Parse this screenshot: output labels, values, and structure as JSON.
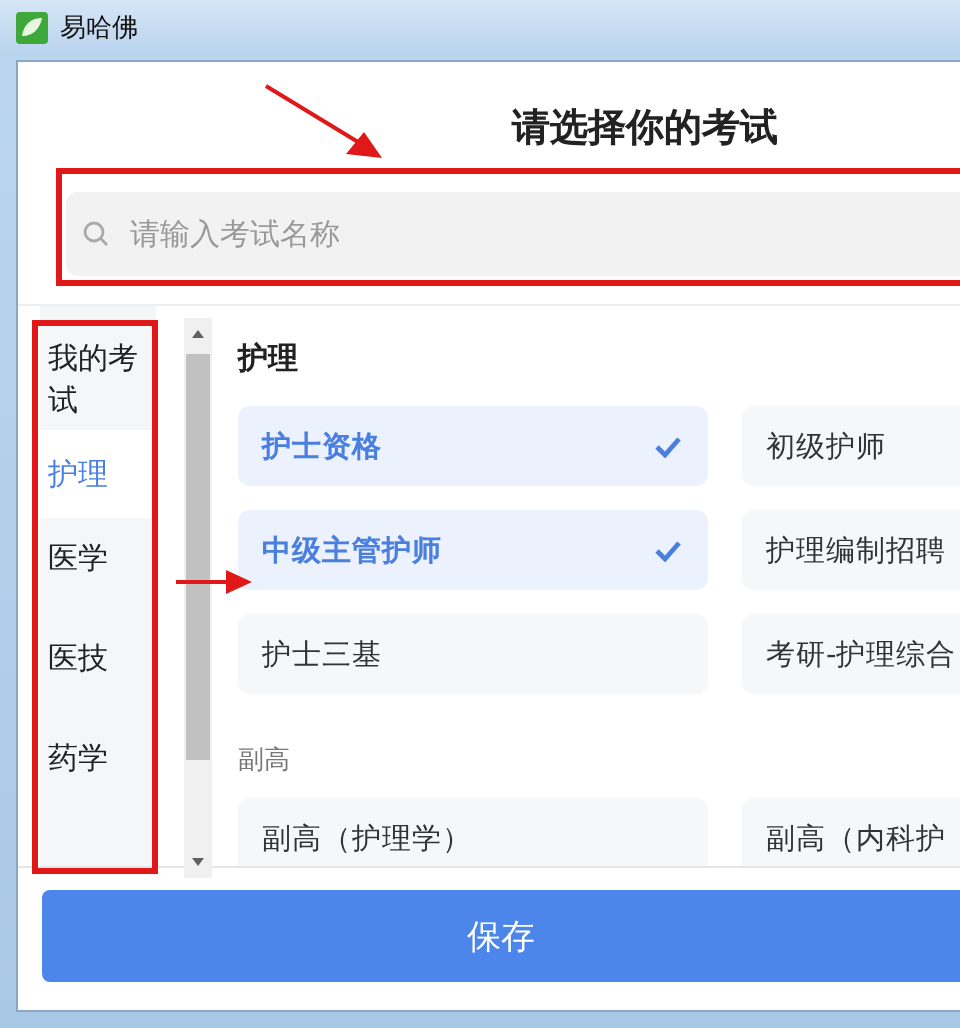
{
  "window": {
    "title": "易哈佛"
  },
  "heading": "请选择你的考试",
  "search": {
    "placeholder": "请输入考试名称"
  },
  "sidebar": {
    "items": [
      {
        "label": "我的考试",
        "selected": false
      },
      {
        "label": "护理",
        "selected": true
      },
      {
        "label": "医学",
        "selected": false
      },
      {
        "label": "医技",
        "selected": false
      },
      {
        "label": "药学",
        "selected": false
      }
    ]
  },
  "sections": [
    {
      "kind": "category",
      "title": "护理",
      "items": [
        {
          "label": "护士资格",
          "selected": true
        },
        {
          "label": "初级护师",
          "selected": false
        },
        {
          "label": "中级主管护师",
          "selected": true
        },
        {
          "label": "护理编制招聘",
          "selected": false
        },
        {
          "label": "护士三基",
          "selected": false
        },
        {
          "label": "考研-护理综合",
          "selected": false
        }
      ]
    },
    {
      "kind": "subgroup",
      "title": "副高",
      "items": [
        {
          "label": "副高（护理学）",
          "selected": false
        },
        {
          "label": "副高（内科护",
          "selected": false
        }
      ]
    }
  ],
  "save_button": "保存"
}
